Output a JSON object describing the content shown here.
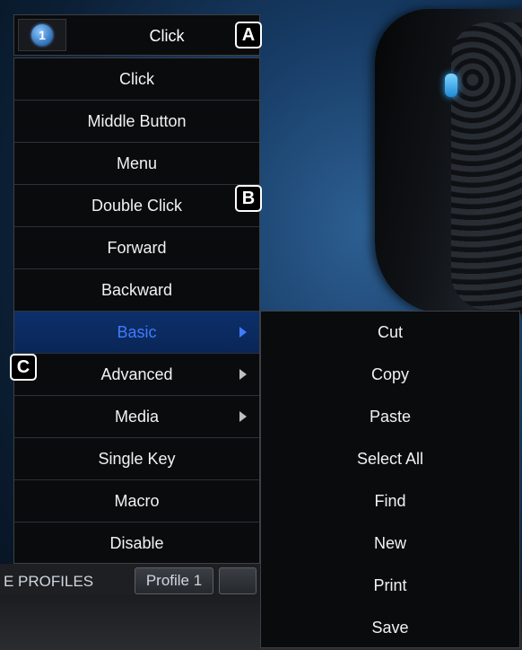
{
  "header": {
    "button_number": "1",
    "current_assignment": "Click"
  },
  "menu": {
    "items": [
      {
        "label": "Click"
      },
      {
        "label": "Middle Button"
      },
      {
        "label": "Menu"
      },
      {
        "label": "Double Click"
      },
      {
        "label": "Forward"
      },
      {
        "label": "Backward"
      },
      {
        "label": "Basic",
        "active": true,
        "submenu": true
      },
      {
        "label": "Advanced",
        "submenu": true
      },
      {
        "label": "Media",
        "submenu": true
      },
      {
        "label": "Single Key"
      },
      {
        "label": "Macro"
      },
      {
        "label": "Disable"
      }
    ]
  },
  "submenu": {
    "items": [
      "Cut",
      "Copy",
      "Paste",
      "Select All",
      "Find",
      "New",
      "Print",
      "Save"
    ]
  },
  "profiles": {
    "section_label": "E PROFILES",
    "profile_name": "Profile 1"
  },
  "callouts": {
    "a": "A",
    "b": "B",
    "c": "C"
  },
  "colors": {
    "menu_background": "#0a0b0d",
    "active_highlight": "#0d2f6b",
    "active_text": "#3f7cff",
    "badge_blue": "#2f6fb8"
  }
}
